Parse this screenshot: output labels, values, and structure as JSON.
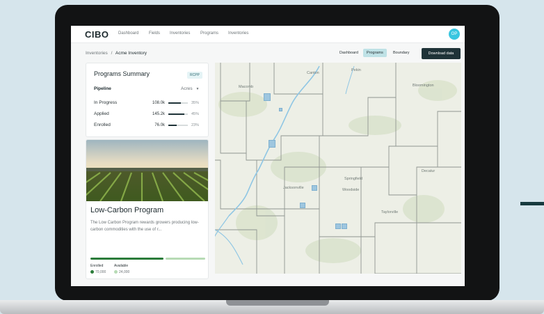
{
  "app": {
    "logo": "CIBO",
    "nav": [
      "Dashboard",
      "Fields",
      "Inventories",
      "Programs",
      "Inventories"
    ],
    "avatar_initials": "OP"
  },
  "breadcrumb": {
    "parent": "Inventories",
    "separator": "/",
    "current": "Acme Inventory"
  },
  "view_tabs": [
    "Dashboard",
    "Programs",
    "Boundary"
  ],
  "active_tab": "Programs",
  "download_label": "Download data",
  "summary": {
    "title": "Programs Summary",
    "badge": "RCPP",
    "pipeline_label": "Pipeline",
    "units": "Acres",
    "rows": [
      {
        "label": "In Progress",
        "amount": "108.0k",
        "pct_label": "35%",
        "fraction": 0.35
      },
      {
        "label": "Applied",
        "amount": "145.2k",
        "pct_label": "45%",
        "fraction": 0.45
      },
      {
        "label": "Enrolled",
        "amount": "76.0k",
        "pct_label": "23%",
        "fraction": 0.23
      }
    ]
  },
  "program": {
    "title": "Low-Carbon Program",
    "description": "The Low Carbon Program rewards growers producing low-carbon commodities with the use of r...",
    "enrolled_label": "Enrolled",
    "available_label": "Available",
    "enrolled_value": "70,000",
    "available_value": "24,000",
    "enrolled_color": "#2b7c3a",
    "available_color": "#b7dbb5"
  },
  "map": {
    "labels": [
      "Canton",
      "Pekin",
      "Macomb",
      "Bloomington",
      "Springfield",
      "Woodside",
      "Jacksonville",
      "Decatur",
      "Taylorville"
    ]
  },
  "colors": {
    "accent": "#39c6e0",
    "dark": "#1f3338",
    "tab_active": "#bfe2e6"
  }
}
